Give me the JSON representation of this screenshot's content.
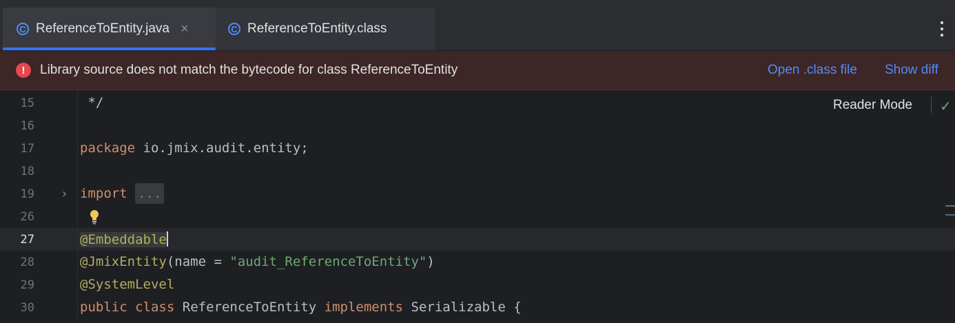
{
  "tabs": [
    {
      "label": "ReferenceToEntity.java",
      "icon": "class-c-icon",
      "active": true,
      "close": "×"
    },
    {
      "label": "ReferenceToEntity.class",
      "icon": "class-c-icon",
      "active": false
    }
  ],
  "banner": {
    "icon": "error-icon",
    "icon_glyph": "!",
    "message": "Library source does not match the bytecode for class ReferenceToEntity",
    "open_class_link": "Open .class file",
    "show_diff_link": "Show diff"
  },
  "editor": {
    "reader_mode": "Reader Mode",
    "check_glyph": "✓",
    "fold_arrow": "›",
    "lines": [
      {
        "num": "15",
        "comment": " */"
      },
      {
        "num": "16"
      },
      {
        "num": "17",
        "kw": "package",
        "rest": " io.jmix.audit.entity;"
      },
      {
        "num": "18"
      },
      {
        "num": "19",
        "kw": "import",
        "folded": "..."
      },
      {
        "num": "26"
      },
      {
        "num": "27",
        "annotation": "@Embeddable"
      },
      {
        "num": "28",
        "annotation": "@JmixEntity",
        "pre": "(name = ",
        "string": "\"audit_ReferenceToEntity\"",
        "post": ")"
      },
      {
        "num": "29",
        "annotation": "@SystemLevel"
      },
      {
        "num": "30",
        "kw1": "public",
        "kw2": "class",
        "name": "ReferenceToEntity",
        "kw3": "implements",
        "iface": "Serializable",
        "brace": "{"
      }
    ]
  },
  "colors": {
    "accent": "#3574f0",
    "link": "#548af7",
    "error": "#e5484d",
    "keyword": "#cf8e6d",
    "annotation": "#b3ae60",
    "string": "#6aab73"
  }
}
